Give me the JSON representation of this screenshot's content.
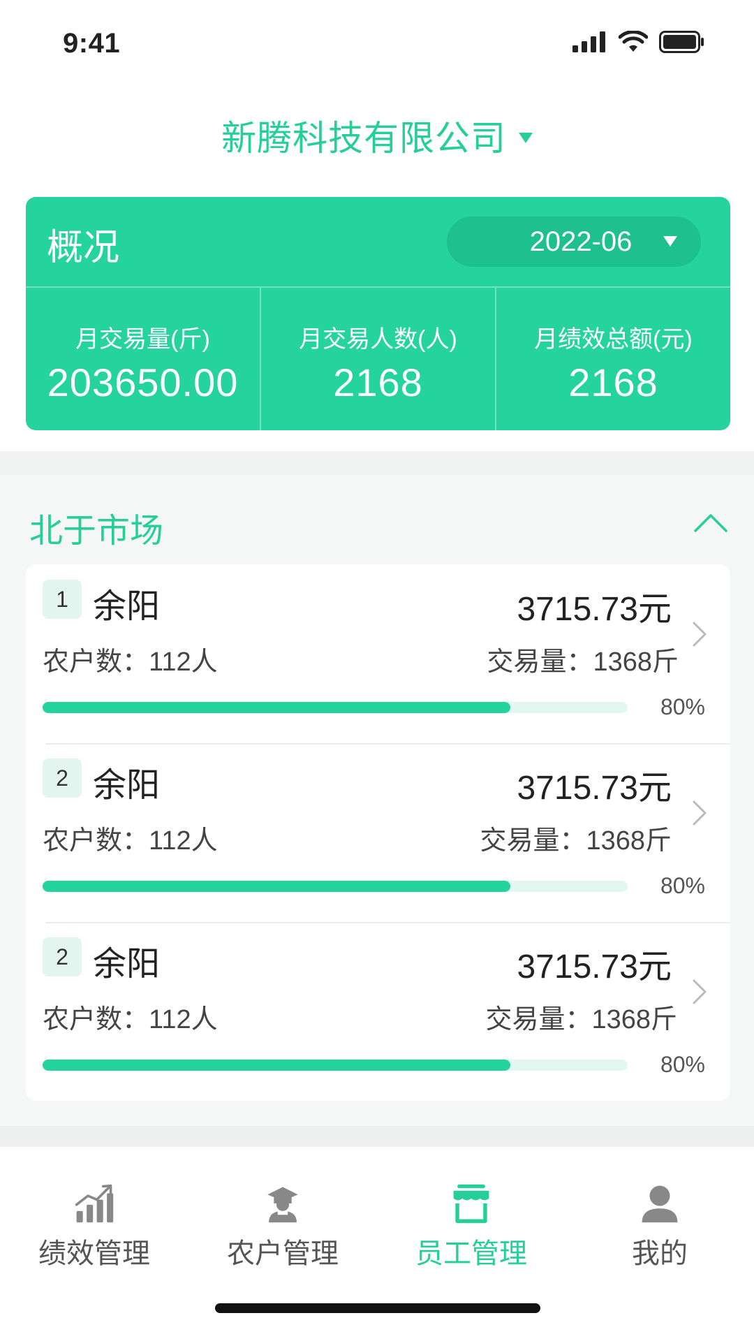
{
  "status_bar": {
    "time": "9:41"
  },
  "header": {
    "company_name": "新腾科技有限公司"
  },
  "overview": {
    "title": "概况",
    "month": "2022-06",
    "stats": [
      {
        "label": "月交易量(斤)",
        "value": "203650.00"
      },
      {
        "label": "月交易人数(人)",
        "value": "2168"
      },
      {
        "label": "月绩效总额(元)",
        "value": "2168"
      }
    ]
  },
  "market": {
    "name": "北于市场",
    "expanded": true,
    "employees": [
      {
        "rank": "1",
        "name": "余阳",
        "amount": "3715.73元",
        "farmers": "农户数：112人",
        "volume": "交易量：1368斤",
        "progress": 0.8,
        "progress_label": "80%"
      },
      {
        "rank": "2",
        "name": "余阳",
        "amount": "3715.73元",
        "farmers": "农户数：112人",
        "volume": "交易量：1368斤",
        "progress": 0.8,
        "progress_label": "80%"
      },
      {
        "rank": "2",
        "name": "余阳",
        "amount": "3715.73元",
        "farmers": "农户数：112人",
        "volume": "交易量：1368斤",
        "progress": 0.8,
        "progress_label": "80%"
      }
    ]
  },
  "tabbar": {
    "active_index": 2,
    "items": [
      {
        "label": "绩效管理",
        "icon": "chart-bar-icon"
      },
      {
        "label": "农户管理",
        "icon": "farmer-icon"
      },
      {
        "label": "员工管理",
        "icon": "store-icon"
      },
      {
        "label": "我的",
        "icon": "user-icon"
      }
    ]
  },
  "colors": {
    "accent": "#24d49c",
    "accent_dark": "#1ec18c",
    "track": "#e1f7ef",
    "inactive": "#888888"
  }
}
